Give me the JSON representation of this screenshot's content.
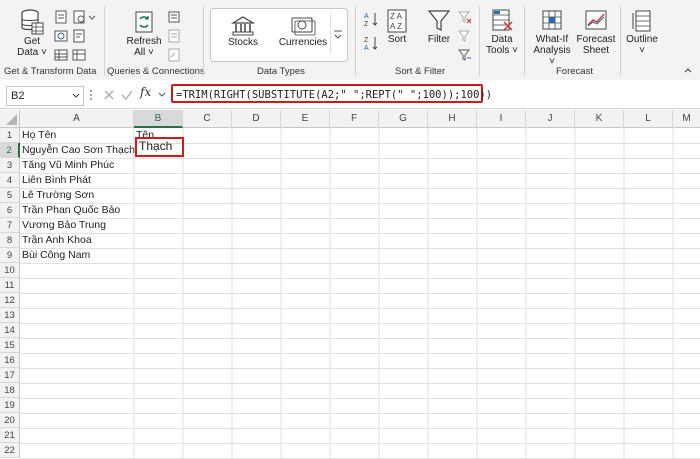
{
  "ribbon": {
    "get_transform": {
      "get_data": "Get",
      "get_data2": "Data ˅",
      "group": "Get & Transform Data"
    },
    "queries": {
      "refresh": "Refresh",
      "refresh2": "All ˅",
      "group": "Queries & Connections"
    },
    "data_types": {
      "stocks": "Stocks",
      "currencies": "Currencies",
      "group": "Data Types"
    },
    "sort_filter": {
      "sort": "Sort",
      "filter": "Filter",
      "group": "Sort & Filter"
    },
    "tools": {
      "data_tools": "Data",
      "data_tools2": "Tools ˅"
    },
    "forecast": {
      "whatif": "What-If",
      "whatif2": "Analysis ˅",
      "sheet": "Forecast",
      "sheet2": "Sheet",
      "group": "Forecast"
    },
    "outline": {
      "label": "Outline",
      "label2": "˅"
    }
  },
  "formula_bar": {
    "name_box": "B2",
    "fx": "fx",
    "formula": "=TRIM(RIGHT(SUBSTITUTE(A2;\" \";REPT(\" \";100));100))"
  },
  "columns": [
    "A",
    "B",
    "C",
    "D",
    "E",
    "F",
    "G",
    "H",
    "I",
    "J",
    "K",
    "L",
    "M"
  ],
  "rows": [
    "1",
    "2",
    "3",
    "4",
    "5",
    "6",
    "7",
    "8",
    "9",
    "10",
    "11",
    "12",
    "13",
    "14",
    "15",
    "16",
    "17",
    "18",
    "19",
    "20",
    "21",
    "22"
  ],
  "cells": {
    "a1": "Họ Tên",
    "b1": "Tên",
    "b2": "Thạch",
    "names": [
      "Nguyễn Cao Sơn Thạch",
      "Tăng Vũ Minh Phúc",
      "Liên Bình Phát",
      "Lê Trường Sơn",
      "Trần Phan Quốc Bảo",
      "Vương Bảo Trung",
      "Trần Anh Khoa",
      "Bùi Công Nam"
    ]
  },
  "colors": {
    "highlight": "#d11a1a",
    "accent_green": "#217346"
  }
}
